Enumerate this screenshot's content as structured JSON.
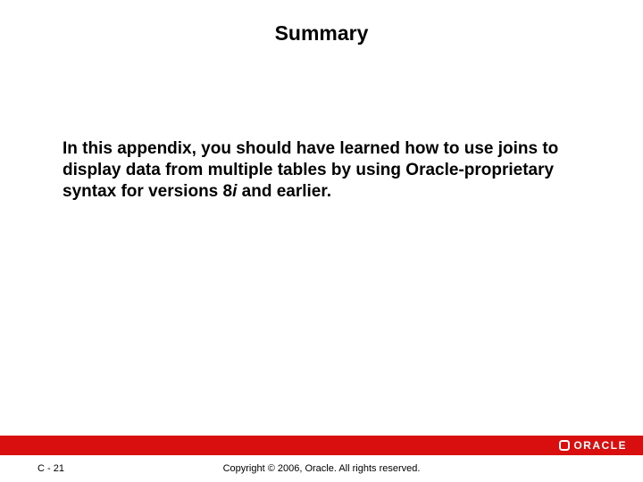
{
  "title": "Summary",
  "body": {
    "prefix": "In this appendix, you should have learned how to use joins to display data from multiple tables by using Oracle-proprietary syntax for versions 8",
    "italic": "i",
    "suffix": " and earlier."
  },
  "logo": {
    "text": "ORACLE"
  },
  "footer": {
    "page": "C - 21",
    "copyright": "Copyright © 2006, Oracle. All rights reserved."
  }
}
